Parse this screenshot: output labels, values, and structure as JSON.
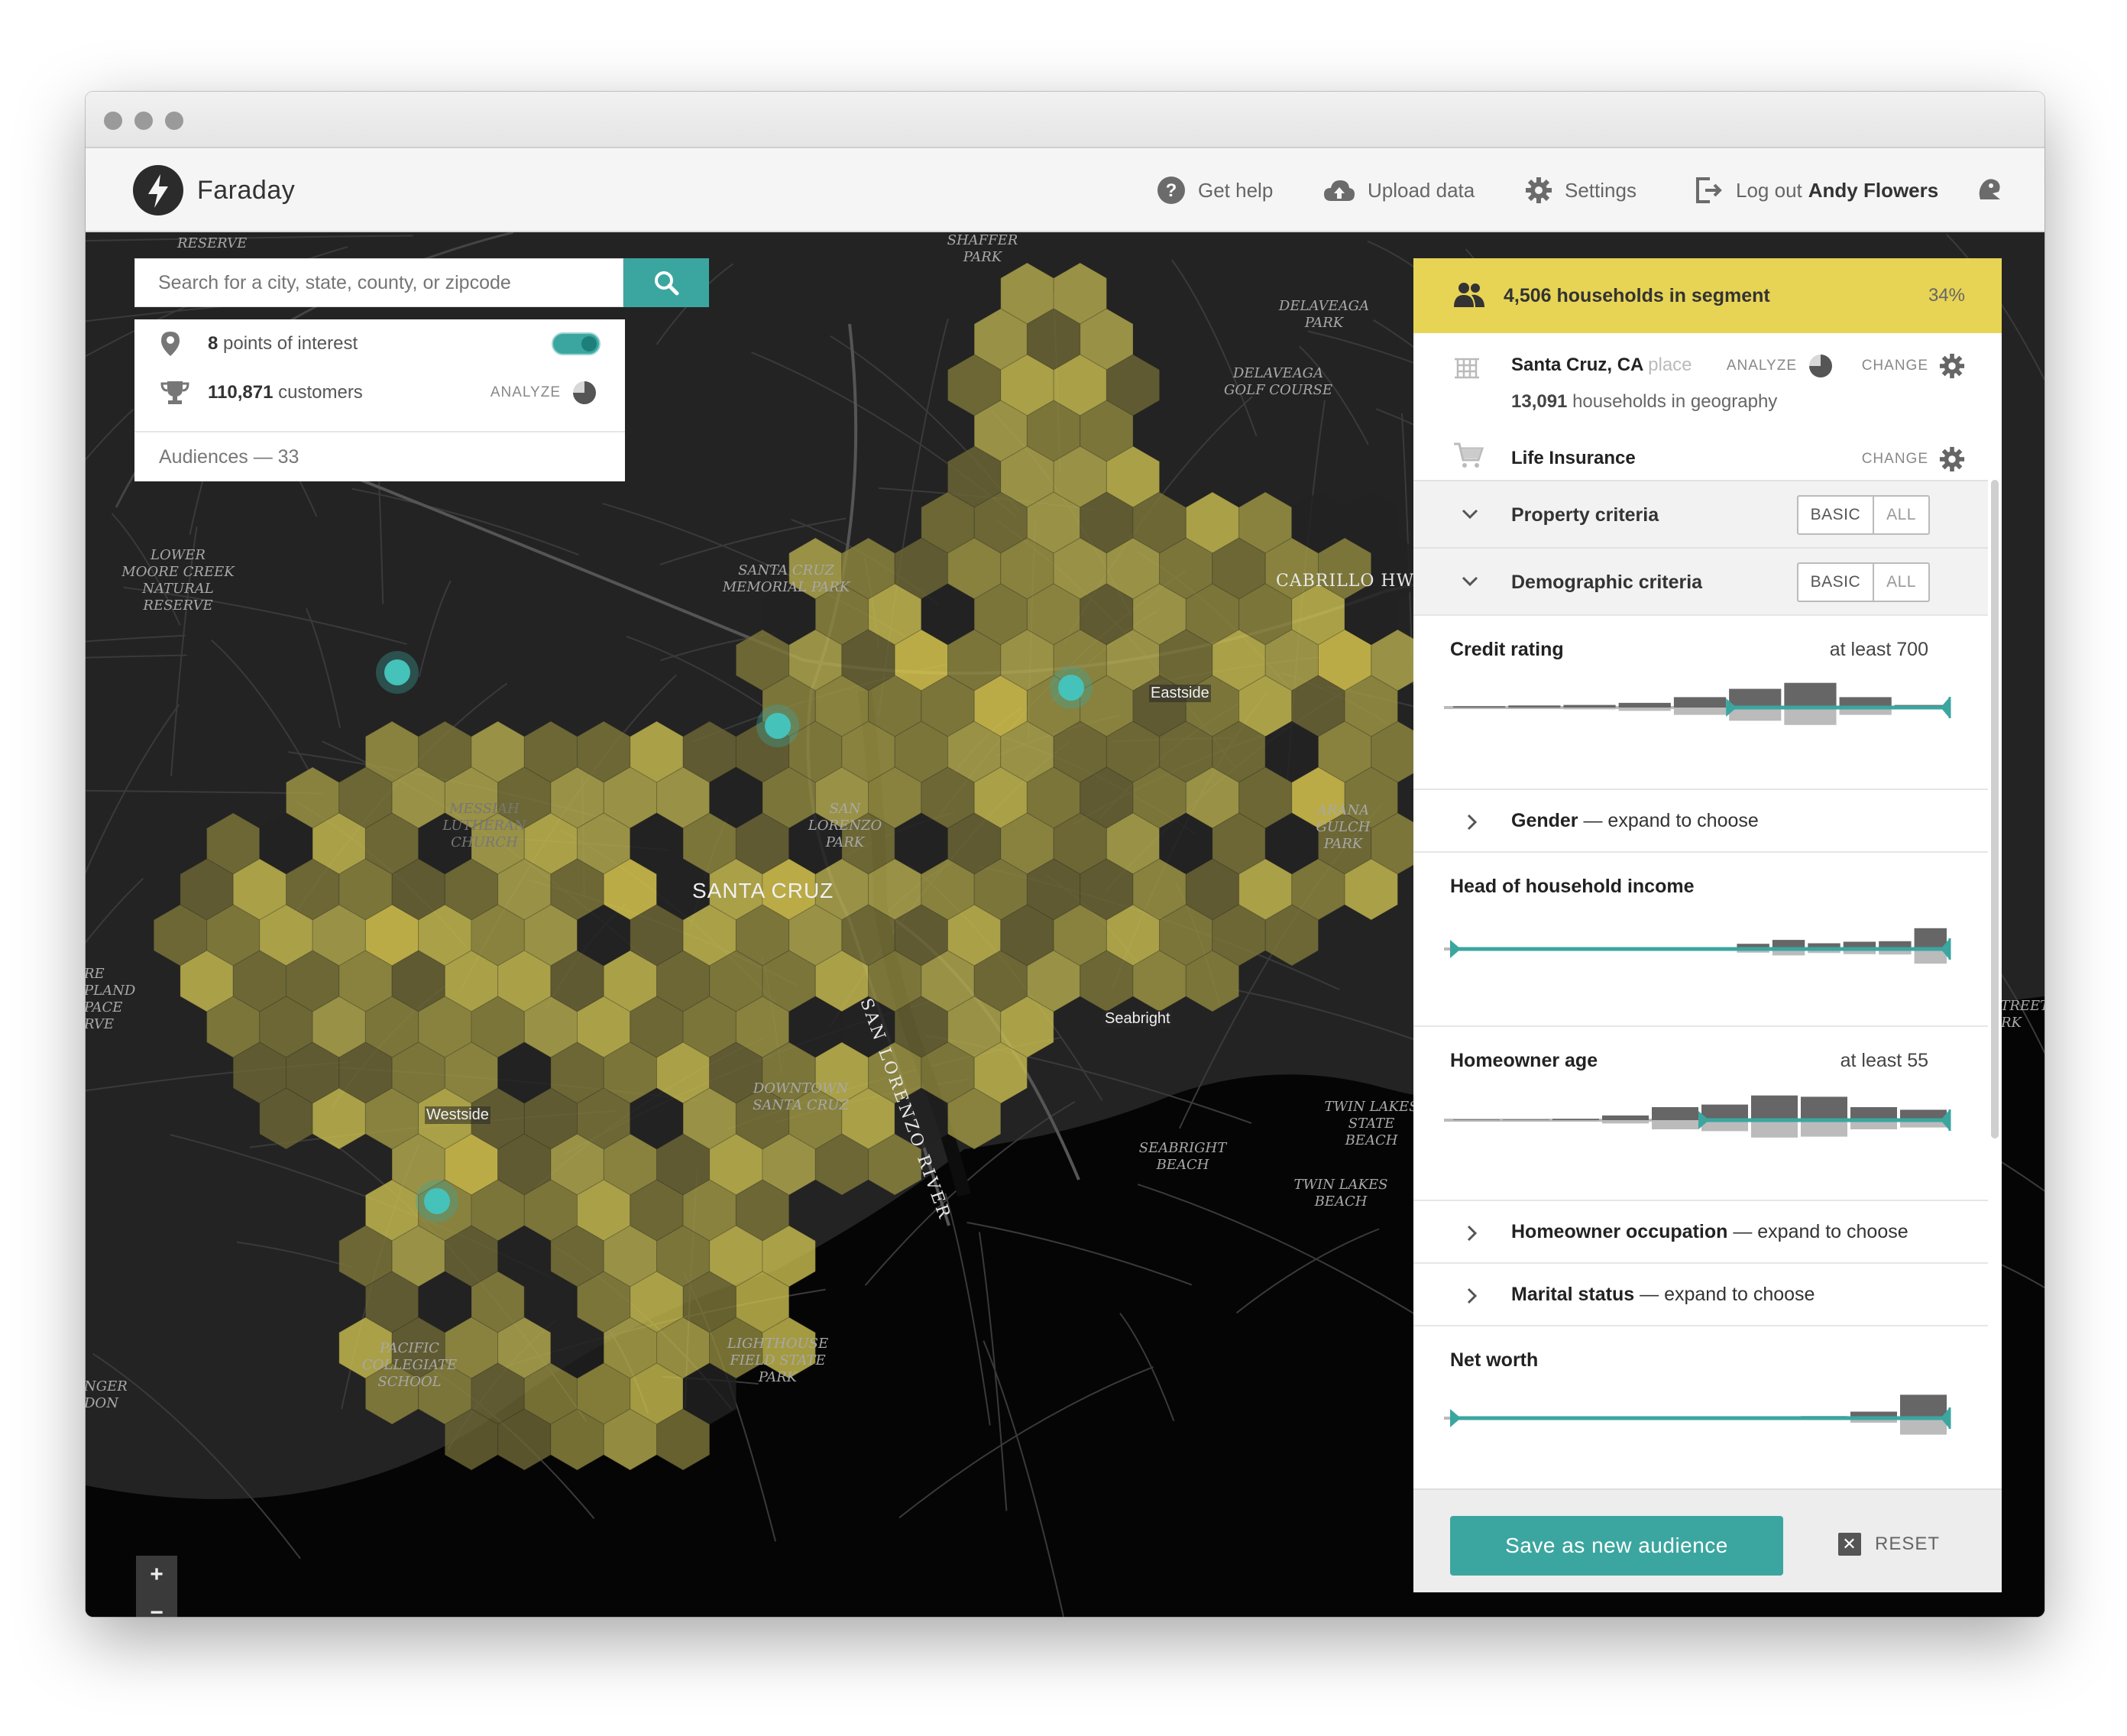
{
  "app": {
    "brand": "Faraday",
    "nav": {
      "help": "Get help",
      "upload": "Upload data",
      "settings": "Settings",
      "logout_prefix": "Log out",
      "user": "Andy Flowers"
    }
  },
  "search": {
    "placeholder": "Search for a city, state, county, or zipcode"
  },
  "poi": {
    "points_count": "8",
    "points_label": "points of interest",
    "points_toggle_on": true,
    "customers_count": "110,871",
    "customers_label": "customers",
    "analyze_label": "ANALYZE",
    "audiences_label": "Audiences — 33"
  },
  "map": {
    "city_label": "SANTA CRUZ",
    "neighborhoods": [
      "Eastside",
      "Seabright",
      "Westside"
    ],
    "places": {
      "reserve_top": "RESERVE",
      "shaffer_park": "SHAFFER PARK",
      "delaveaga_park": "DELAVEAGA PARK",
      "delaveaga_golf": "DELAVEAGA GOLF COURSE",
      "lower_moore": "LOWER MOORE CREEK NATURAL RESERVE",
      "memorial_park": "SANTA CRUZ MEMORIAL PARK",
      "cabrillo": "CABRILLO HWY",
      "messiah": "MESSIAH LUTHERAN CHURCH",
      "san_lorenzo_park": "SAN LORENZO PARK",
      "river": "SAN LORENZO RIVER",
      "arana": "ARANA GULCH PARK",
      "downtown": "DOWNTOWN SANTA CRUZ",
      "seabright_beach": "SEABRIGHT BEACH",
      "twin_lakes_sb": "TWIN LAKES STATE BEACH",
      "twin_lakes": "TWIN LAKES BEACH",
      "pacific": "PACIFIC COLLEGIATE SCHOOL",
      "lighthouse": "LIGHTHOUSE FIELD STATE PARK",
      "left_upland": "RE PLAND PACE RVE",
      "left_ranger": "NGER DON",
      "right_street": "STREET ARK"
    },
    "zoom_in": "+",
    "zoom_out": "−"
  },
  "panel": {
    "segment": {
      "title": "4,506 households in segment",
      "percent": "34%"
    },
    "geography": {
      "name": "Santa Cruz, CA",
      "type": "place",
      "households_count": "13,091",
      "households_label": "households in geography",
      "analyze_label": "ANALYZE",
      "change_label": "CHANGE"
    },
    "outcome": {
      "name": "Life Insurance",
      "change_label": "CHANGE"
    },
    "criteria_groups": [
      {
        "label": "Property criteria",
        "basic": "BASIC",
        "all": "ALL"
      },
      {
        "label": "Demographic criteria",
        "basic": "BASIC",
        "all": "ALL"
      }
    ],
    "filters": {
      "credit": {
        "name": "Credit rating",
        "value": "at least 700"
      },
      "gender": {
        "name": "Gender",
        "hint": " — expand to choose"
      },
      "income": {
        "name": "Head of household income",
        "value": ""
      },
      "age": {
        "name": "Homeowner age",
        "value": "at least 55"
      },
      "occupation": {
        "name": "Homeowner occupation",
        "hint": " — expand to choose"
      },
      "marital": {
        "name": "Marital status",
        "hint": " — expand to choose"
      },
      "networth": {
        "name": "Net worth",
        "value": ""
      }
    },
    "save_label": "Save as new audience",
    "reset_label": "RESET"
  },
  "colors": {
    "accent": "#3ba69f",
    "segment_banner": "#e7d455",
    "hex_fill": "#8f8840",
    "map_background": "#1f1f1f"
  }
}
